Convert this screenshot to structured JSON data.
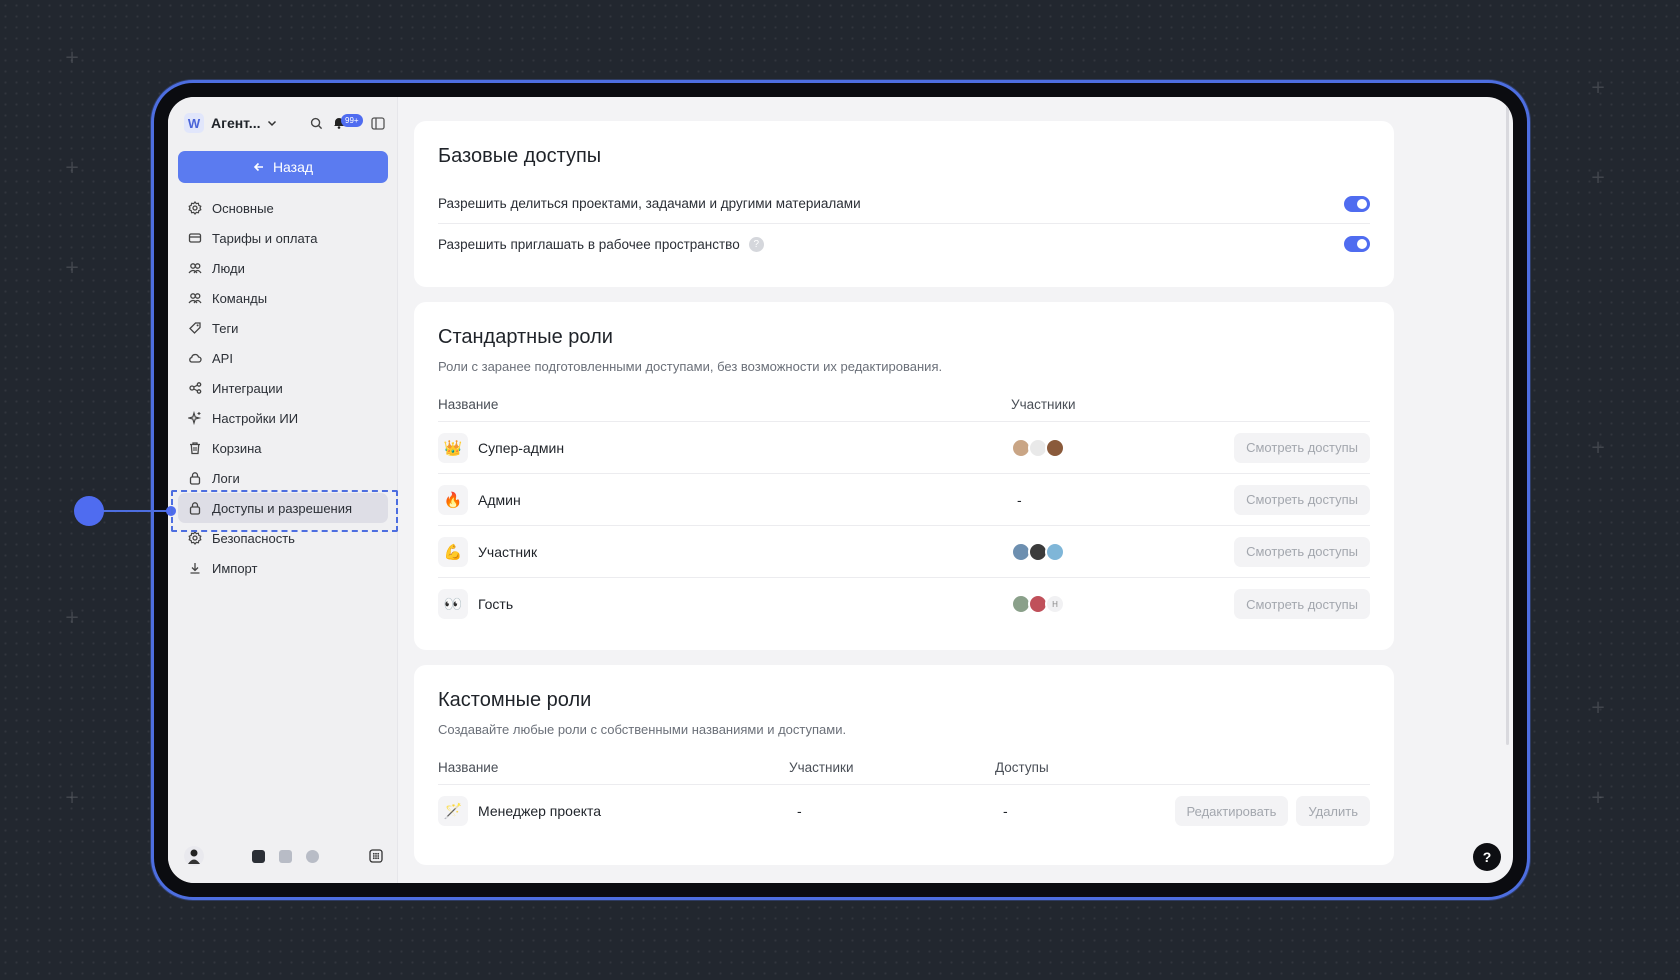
{
  "colors": {
    "accent": "#4f6cf0",
    "frame": "#4d6ee0",
    "background": "#22272f"
  },
  "workspace": {
    "logo_letter": "W",
    "name": "Агент...",
    "notifications_badge": "99+"
  },
  "sidebar": {
    "back_label": "Назад",
    "items": [
      {
        "label": "Основные",
        "icon": "gear-icon"
      },
      {
        "label": "Тарифы и оплата",
        "icon": "card-icon"
      },
      {
        "label": "Люди",
        "icon": "people-icon"
      },
      {
        "label": "Команды",
        "icon": "people-icon"
      },
      {
        "label": "Теги",
        "icon": "tag-icon"
      },
      {
        "label": "API",
        "icon": "cloud-icon"
      },
      {
        "label": "Интеграции",
        "icon": "integrations-icon"
      },
      {
        "label": "Настройки ИИ",
        "icon": "sparkle-icon"
      },
      {
        "label": "Корзина",
        "icon": "trash-icon"
      },
      {
        "label": "Логи",
        "icon": "lock-icon"
      },
      {
        "label": "Доступы и разрешения",
        "icon": "lock-icon",
        "active": true
      },
      {
        "label": "Безопасность",
        "icon": "gear-icon"
      },
      {
        "label": "Импорт",
        "icon": "download-icon"
      }
    ]
  },
  "basic_access": {
    "title": "Базовые доступы",
    "rows": [
      {
        "label": "Разрешить делиться проектами, задачами и другими материалами",
        "enabled": true
      },
      {
        "label": "Разрешить приглашать в рабочее пространство",
        "enabled": true,
        "help": "?"
      }
    ]
  },
  "standard_roles": {
    "title": "Стандартные роли",
    "subtitle": "Роли с заранее подготовленными доступами, без возможности их редактирования.",
    "col_name": "Название",
    "col_members": "Участники",
    "action_label": "Смотреть доступы",
    "rows": [
      {
        "emoji": "👑",
        "name": "Супер-админ",
        "members": ""
      },
      {
        "emoji": "🔥",
        "name": "Админ",
        "members": "-"
      },
      {
        "emoji": "💪",
        "name": "Участник",
        "members": ""
      },
      {
        "emoji": "👀",
        "name": "Гость",
        "members": "",
        "extra_member_initial": "Н"
      }
    ]
  },
  "custom_roles": {
    "title": "Кастомные роли",
    "subtitle": "Создавайте любые роли с собственными названиями и доступами.",
    "col_name": "Название",
    "col_members": "Участники",
    "col_access": "Доступы",
    "edit_label": "Редактировать",
    "delete_label": "Удалить",
    "rows": [
      {
        "emoji": "🪄",
        "name": "Менеджер проекта",
        "members": "-",
        "access": "-"
      }
    ]
  },
  "help_button": "?"
}
